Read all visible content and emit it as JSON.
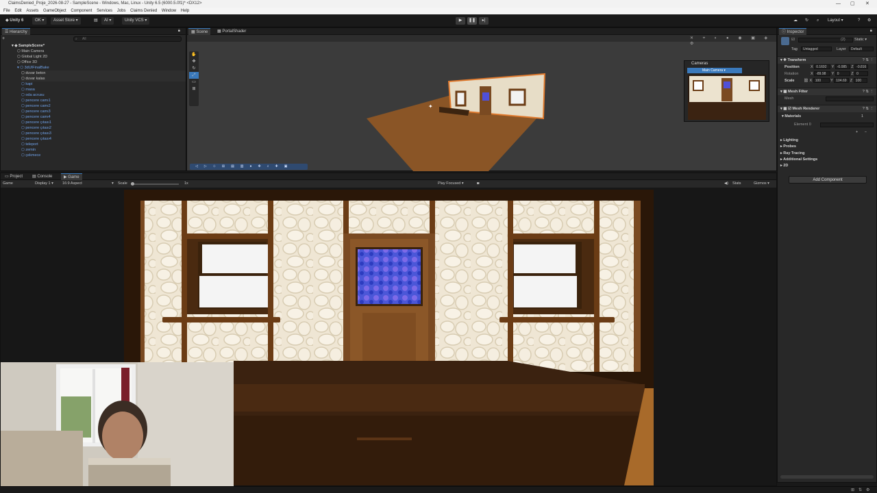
{
  "window": {
    "title": "ClaimsDenied_Proje_2026-08-27 - SampleScene - Windows, Mac, Linux - Unity 6.5 (6000.5.0f1)* <DX12>"
  },
  "menu": [
    "File",
    "Edit",
    "Assets",
    "GameObject",
    "Component",
    "Services",
    "Jobs",
    "Claims Denied",
    "Window",
    "Help"
  ],
  "toolbar": {
    "account": "Unity 6",
    "ok": "OK",
    "asset_store": "Asset Store",
    "ai": "AI",
    "vcs": "Unity VCS",
    "layout": "Layout"
  },
  "hierarchy": {
    "tab": "Hierarchy",
    "search_placeholder": "All",
    "scene": "SampleScene*",
    "items": [
      {
        "label": "Main Camera",
        "indent": 1,
        "blue": false
      },
      {
        "label": "Global Light 2D",
        "indent": 1,
        "blue": false
      },
      {
        "label": "Office 3D",
        "indent": 1,
        "blue": false
      },
      {
        "label": "3dUIFinalBake",
        "indent": 1,
        "blue": true
      },
      {
        "label": "duvar beton",
        "indent": 2,
        "blue": false
      },
      {
        "label": "duvar kalas",
        "indent": 2,
        "blue": false
      },
      {
        "label": "kapi",
        "indent": 2,
        "blue": true
      },
      {
        "label": "masa",
        "indent": 2,
        "blue": true
      },
      {
        "label": "oda acrusu",
        "indent": 2,
        "blue": true
      },
      {
        "label": "pencere camı1",
        "indent": 2,
        "blue": true
      },
      {
        "label": "pencere camı2",
        "indent": 2,
        "blue": true
      },
      {
        "label": "pencere camı3",
        "indent": 2,
        "blue": true
      },
      {
        "label": "pencere camı4",
        "indent": 2,
        "blue": true
      },
      {
        "label": "pencere çıtası1",
        "indent": 2,
        "blue": true
      },
      {
        "label": "pencere çıtası2",
        "indent": 2,
        "blue": true
      },
      {
        "label": "pencere çıtası3",
        "indent": 2,
        "blue": true
      },
      {
        "label": "pencere çıtası4",
        "indent": 2,
        "blue": true
      },
      {
        "label": "teleport",
        "indent": 2,
        "blue": true
      },
      {
        "label": "zemin",
        "indent": 2,
        "blue": true
      },
      {
        "label": "çekmece",
        "indent": 2,
        "blue": true
      }
    ]
  },
  "scene": {
    "tabs": [
      "Scene",
      "PortalShader"
    ],
    "cameras_overlay": "Cameras",
    "camera_select": "Main Camera"
  },
  "bottom_tabs": [
    "Project",
    "Console",
    "Game"
  ],
  "game_bar": {
    "mode": "Game",
    "display": "Display 1",
    "aspect": "16:9 Aspect",
    "scale_label": "Scale",
    "scale_value": "1x",
    "play_focused": "Play Focused",
    "stats": "Stats",
    "gizmos": "Gizmos"
  },
  "inspector": {
    "tab": "Inspector",
    "static": "Static",
    "tag_label": "Tag",
    "tag": "Untagged",
    "layer_label": "Layer",
    "layer": "Default",
    "transform": "Transform",
    "position": {
      "label": "Position",
      "x": "0.1692",
      "y": "-0.085",
      "z": "-0.816"
    },
    "rotation": {
      "label": "Rotation",
      "x": "-89.98",
      "y": "0",
      "z": "0"
    },
    "scale": {
      "label": "Scale",
      "x": "100",
      "y": "104.69",
      "z": "100"
    },
    "mesh_filter": "Mesh Filter",
    "mesh_label": "Mesh",
    "mesh_renderer": "Mesh Renderer",
    "materials": "Materials",
    "materials_count": "1",
    "element0": "Element 0",
    "lighting": "Lighting",
    "probes": "Probes",
    "ray_tracing": "Ray Tracing",
    "additional": "Additional Settings",
    "twod": "2D",
    "add_component": "Add Component",
    "count": "(2)"
  },
  "colors": {
    "accent": "#3a79bb",
    "link": "#6fa1e8",
    "panel": "#282828",
    "wood": "#7a4a22"
  }
}
